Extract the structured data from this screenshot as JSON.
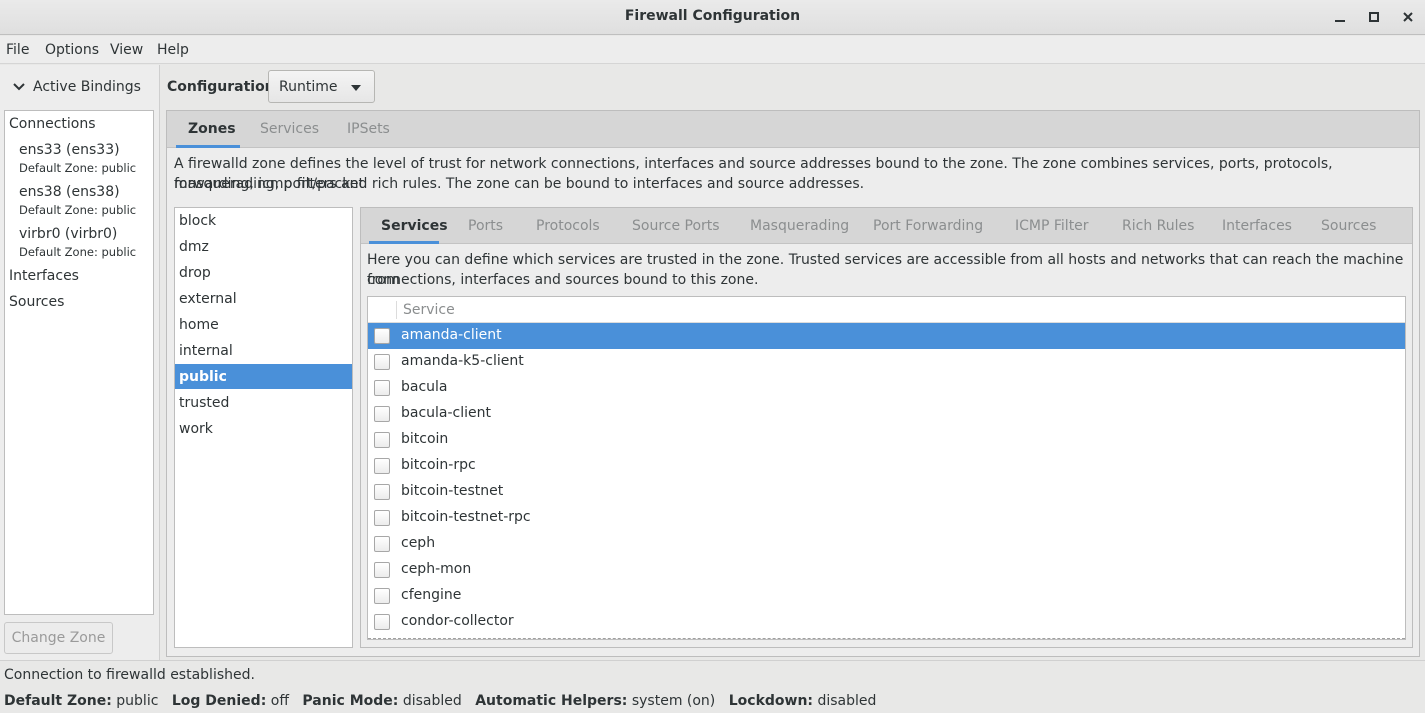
{
  "window": {
    "title": "Firewall Configuration"
  },
  "menu": [
    "File",
    "Options",
    "View",
    "Help"
  ],
  "bindings": {
    "header": "Active Bindings",
    "connections_label": "Connections",
    "connections": [
      {
        "name": "ens33 (ens33)",
        "zone": "Default Zone: public"
      },
      {
        "name": "ens38 (ens38)",
        "zone": "Default Zone: public"
      },
      {
        "name": "virbr0 (virbr0)",
        "zone": "Default Zone: public"
      }
    ],
    "interfaces_label": "Interfaces",
    "sources_label": "Sources",
    "change_zone_label": "Change Zone"
  },
  "configuration": {
    "label": "Configuration:",
    "value": "Runtime"
  },
  "main_tabs": [
    "Zones",
    "Services",
    "IPSets"
  ],
  "zone_description_line1": "A firewalld zone defines the level of trust for network connections, interfaces and source addresses bound to the zone. The zone combines services, ports, protocols, masquerading, port/packet",
  "zone_description_line2": "forwarding, icmp filters and rich rules. The zone can be bound to interfaces and source addresses.",
  "zones": [
    "block",
    "dmz",
    "drop",
    "external",
    "home",
    "internal",
    "public",
    "trusted",
    "work"
  ],
  "selected_zone": "public",
  "sub_tabs": [
    "Services",
    "Ports",
    "Protocols",
    "Source Ports",
    "Masquerading",
    "Port Forwarding",
    "ICMP Filter",
    "Rich Rules",
    "Interfaces",
    "Sources"
  ],
  "services_description_line1": "Here you can define which services are trusted in the zone. Trusted services are accessible from all hosts and networks that can reach the machine from",
  "services_description_line2": "connections, interfaces and sources bound to this zone.",
  "service_column_header": "Service",
  "services": [
    "amanda-client",
    "amanda-k5-client",
    "bacula",
    "bacula-client",
    "bitcoin",
    "bitcoin-rpc",
    "bitcoin-testnet",
    "bitcoin-testnet-rpc",
    "ceph",
    "ceph-mon",
    "cfengine",
    "condor-collector"
  ],
  "selected_service": "amanda-client",
  "status": {
    "message": "Connection to firewalld established.",
    "default_zone_label": "Default Zone:",
    "default_zone": "public",
    "log_denied_label": "Log Denied:",
    "log_denied": "off",
    "panic_mode_label": "Panic Mode:",
    "panic_mode": "disabled",
    "helpers_label": "Automatic Helpers:",
    "helpers": "system (on)",
    "lockdown_label": "Lockdown:",
    "lockdown": "disabled"
  },
  "colors": {
    "selection": "#4a90d9"
  }
}
